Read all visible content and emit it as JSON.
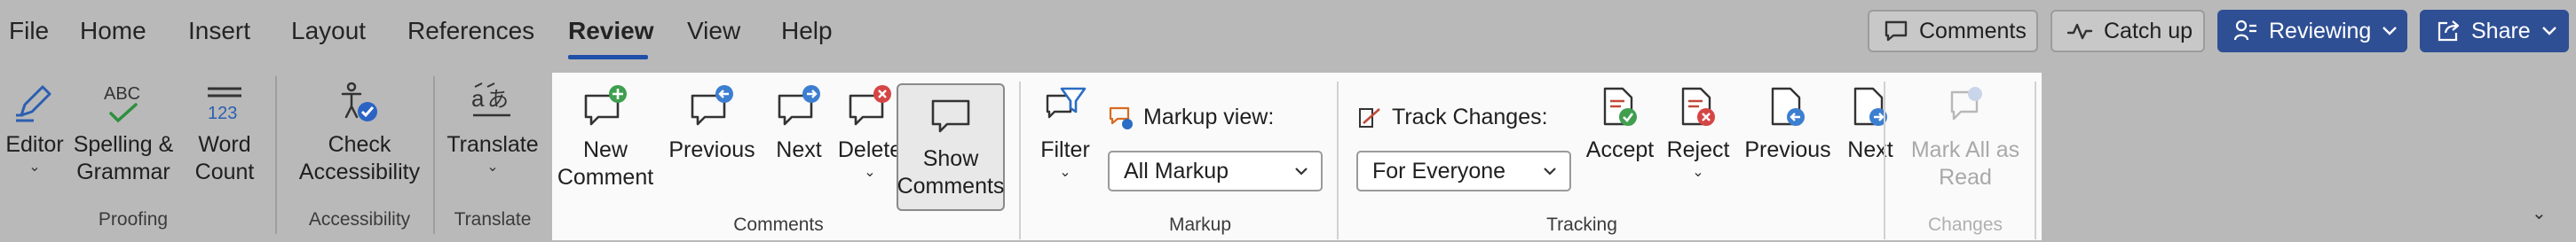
{
  "menu": {
    "tabs": [
      {
        "label": "File"
      },
      {
        "label": "Home"
      },
      {
        "label": "Insert"
      },
      {
        "label": "Layout"
      },
      {
        "label": "References"
      },
      {
        "label": "Review",
        "active": true
      },
      {
        "label": "View"
      },
      {
        "label": "Help"
      }
    ],
    "comments_button": "Comments",
    "catchup_button": "Catch up",
    "reviewing_button": "Reviewing",
    "share_button": "Share"
  },
  "ribbon": {
    "proofing": {
      "label": "Proofing",
      "editor": "Editor",
      "spelling": "Spelling &\nGrammar",
      "word_count": "Word\nCount",
      "spelling_icon_text": "ABC",
      "word_count_icon_text": "123"
    },
    "accessibility": {
      "label": "Accessibility",
      "check": "Check\nAccessibility"
    },
    "translate": {
      "label": "Translate",
      "translate": "Translate"
    },
    "comments": {
      "label": "Comments",
      "new_comment": "New\nComment",
      "previous": "Previous",
      "next": "Next",
      "delete": "Delete",
      "show_comments": "Show\nComments"
    },
    "markup": {
      "label": "Markup",
      "filter": "Filter",
      "markup_view_label": "Markup view:",
      "markup_view_value": "All Markup"
    },
    "tracking": {
      "label": "Tracking",
      "track_changes_label": "Track Changes:",
      "track_changes_value": "For Everyone",
      "accept": "Accept",
      "reject": "Reject",
      "previous": "Previous",
      "next": "Next"
    },
    "changes": {
      "label": "Changes",
      "mark_all_read": "Mark All as\nRead"
    }
  },
  "colors": {
    "accent": "#2f4f94",
    "ribbon_bg": "#b9b9b9",
    "highlight_bg": "#fafafa",
    "add_green": "#3f9f4f",
    "blue_badge": "#3c7fd0",
    "red_badge": "#d64545"
  }
}
